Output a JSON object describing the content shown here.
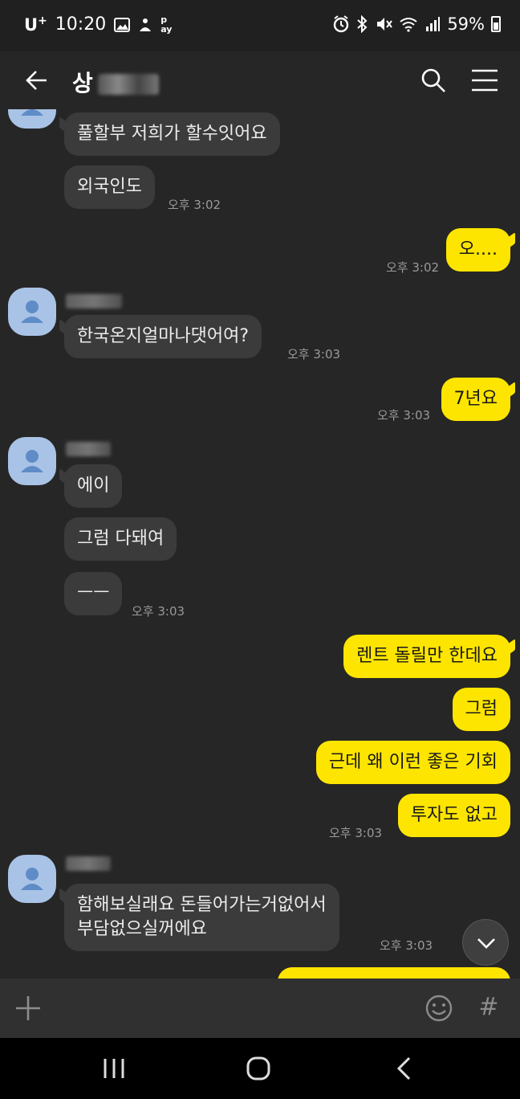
{
  "status_bar": {
    "carrier": "U",
    "carrier_sup": "+",
    "time": "10:20",
    "battery": "59%",
    "icons": [
      "gallery-icon",
      "samsung-pay-icon",
      "alarm-icon",
      "bluetooth-icon",
      "mute-icon",
      "wifi-icon",
      "signal-icon",
      "battery-icon"
    ]
  },
  "header": {
    "title": "상"
  },
  "messages": [
    {
      "dir": "in",
      "text": "풀할부 저희가 할수잇어요"
    },
    {
      "dir": "in",
      "text": "외국인도",
      "time": "오후 3:02"
    },
    {
      "dir": "out",
      "text": "오....",
      "time": "오후 3:02"
    },
    {
      "dir": "in",
      "text": "한국온지얼마나댓어여?",
      "time": "오후 3:03"
    },
    {
      "dir": "out",
      "text": "7년요",
      "time": "오후 3:03"
    },
    {
      "dir": "in",
      "text": "에이"
    },
    {
      "dir": "in",
      "text": "그럼 다돼여"
    },
    {
      "dir": "in",
      "text": "ㅡㅡ",
      "time": "오후 3:03"
    },
    {
      "dir": "out",
      "text": "렌트 돌릴만 한데요"
    },
    {
      "dir": "out",
      "text": "그럼"
    },
    {
      "dir": "out",
      "text": "근데 왜 이런 좋은 기회"
    },
    {
      "dir": "out",
      "text": "투자도 없고",
      "time": "오후 3:03"
    },
    {
      "dir": "in",
      "text_line1": "함해보실래요 돈들어가는거없어서",
      "text_line2": "부담없으실꺼에요",
      "time": "오후 3:03"
    }
  ],
  "input_bar": {
    "hash": "#"
  },
  "colors": {
    "background": "#262626",
    "bubble_in": "#3b3b3b",
    "bubble_out": "#fee500",
    "avatar": "#a9c3e6"
  }
}
